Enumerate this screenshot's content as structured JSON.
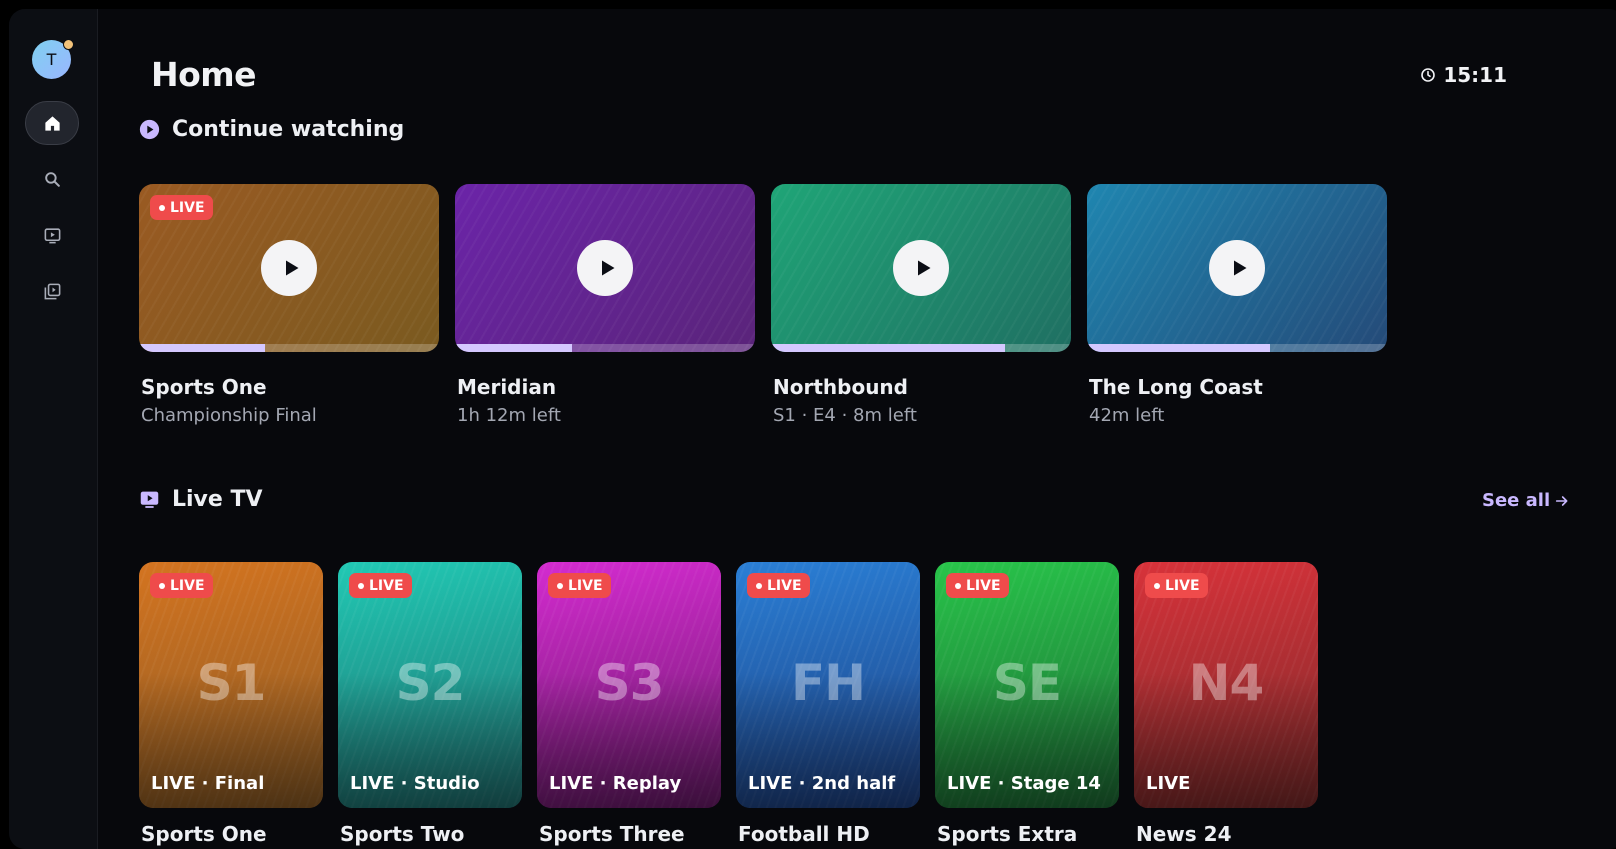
{
  "user": {
    "initial": "T"
  },
  "header": {
    "title": "Home",
    "time": "15:11"
  },
  "nav": {
    "items": [
      {
        "name": "home",
        "icon": "home-icon",
        "active": true
      },
      {
        "name": "search",
        "icon": "search-icon",
        "active": false
      },
      {
        "name": "live-tv",
        "icon": "tv-icon",
        "active": false
      },
      {
        "name": "library",
        "icon": "library-icon",
        "active": false
      }
    ]
  },
  "continue_watching": {
    "title": "Continue watching",
    "icon": "play-circle-icon",
    "items": [
      {
        "title": "Sports One",
        "subtitle": "Championship Final",
        "live": true,
        "live_label": "LIVE",
        "progress": 0.42,
        "color_from": "#9a5a22",
        "color_to": "#7a5a20"
      },
      {
        "title": "Meridian",
        "subtitle": "1h 12m left",
        "live": false,
        "progress": 0.39,
        "color_from": "#6b24a8",
        "color_to": "#5a247a"
      },
      {
        "title": "Northbound",
        "subtitle": "S1 · E4 · 8m left",
        "live": false,
        "progress": 0.78,
        "color_from": "#1fa577",
        "color_to": "#1f6f62"
      },
      {
        "title": "The Long Coast",
        "subtitle": "42m left",
        "live": false,
        "progress": 0.61,
        "color_from": "#1f86b0",
        "color_to": "#244a78"
      }
    ]
  },
  "live_tv": {
    "title": "Live TV",
    "icon": "tv-icon",
    "see_all": "See all",
    "items": [
      {
        "mono": "S1",
        "status": "LIVE · Final",
        "name": "Sports One",
        "live_label": "LIVE",
        "color_from": "#d47420",
        "color_to": "#8a5a24"
      },
      {
        "mono": "S2",
        "status": "LIVE · Studio",
        "name": "Sports Two",
        "live_label": "LIVE",
        "color_from": "#21c9b4",
        "color_to": "#1f6e6e"
      },
      {
        "mono": "S3",
        "status": "LIVE · Replay",
        "name": "Sports Three",
        "live_label": "LIVE",
        "color_from": "#d42bd0",
        "color_to": "#6a1a6a"
      },
      {
        "mono": "FH",
        "status": "LIVE · 2nd half",
        "name": "Football HD",
        "live_label": "LIVE",
        "color_from": "#2a7fd6",
        "color_to": "#1d3f80"
      },
      {
        "mono": "SE",
        "status": "LIVE · Stage 14",
        "name": "Sports Extra",
        "live_label": "LIVE",
        "color_from": "#28c44a",
        "color_to": "#1d6a34"
      },
      {
        "mono": "N4",
        "status": "LIVE",
        "name": "News 24",
        "live_label": "LIVE",
        "color_from": "#d8323a",
        "color_to": "#7a2a2a"
      }
    ]
  }
}
